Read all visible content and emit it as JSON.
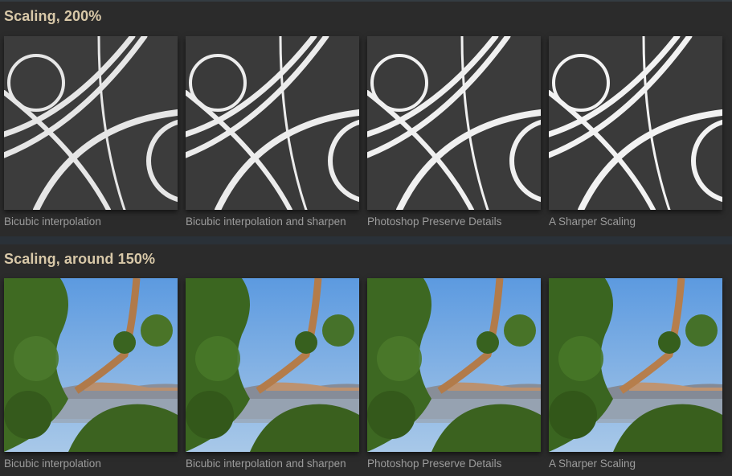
{
  "sections": [
    {
      "title": "Scaling, 200%",
      "captions": [
        "Bicubic interpolation",
        "Bicubic interpolation and sharpen",
        "Photoshop Preserve Details",
        "A Sharper Scaling"
      ]
    },
    {
      "title": "Scaling, around 150%",
      "captions": [
        "Bicubic interpolation",
        "Bicubic interpolation and sharpen",
        "Photoshop Preserve Details",
        "A Sharper Scaling"
      ]
    }
  ],
  "colors": {
    "title": "#d8c8a8",
    "caption": "#9c9c9c",
    "panel": "#2b2b2b",
    "arc_tile_bg": "#3c3c3c",
    "arc_stroke": "#e6e6e6",
    "sky": "#6ea8e0",
    "foliage": "#3f6a22",
    "branch": "#b07a4a"
  }
}
